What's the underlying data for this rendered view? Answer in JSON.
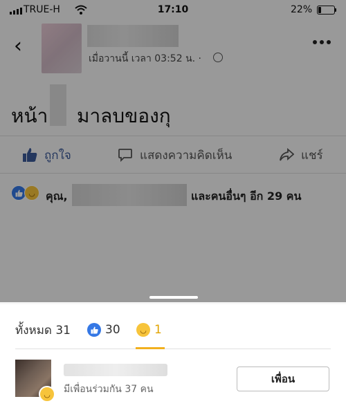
{
  "status_bar": {
    "carrier": "TRUE-H",
    "time": "17:10",
    "battery": "22%",
    "battery_level": 0.22
  },
  "post_header": {
    "timestamp": "เมื่อวานนี้ เวลา 03:52 น. ·",
    "icons": [
      "back-chevron-icon",
      "globe-icon",
      "more-icon"
    ]
  },
  "post": {
    "text_before": "หน้า",
    "text_after": "มาลบของกุ"
  },
  "actions": {
    "like": "ถูกใจ",
    "comment": "แสดงความคิดเห็น",
    "share": "แชร์"
  },
  "reactions_summary": {
    "you": "คุณ,",
    "others": "และคนอื่นๆ อีก 29 คน"
  },
  "sheet": {
    "tabs": [
      {
        "label": "ทั้งหมด 31"
      },
      {
        "label": "30",
        "icon": "like-icon"
      },
      {
        "label": "1",
        "icon": "haha-icon"
      }
    ],
    "users": [
      {
        "mutual": "มีเพื่อนร่วมกัน 37 คน",
        "button": "เพื่อน"
      }
    ]
  },
  "colors": {
    "like_blue": "#3578e5",
    "haha_yellow": "#f7c43b",
    "active_tab": "#f2b01e"
  }
}
